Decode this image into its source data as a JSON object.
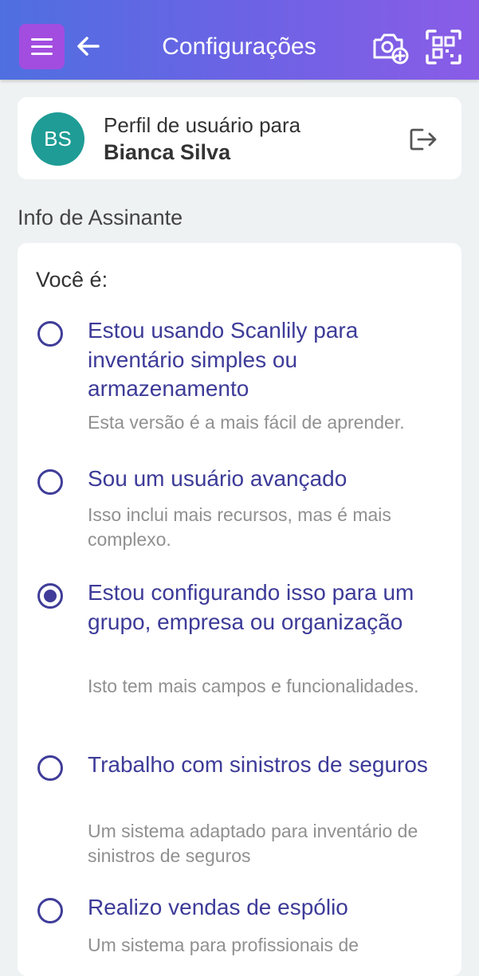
{
  "header": {
    "title": "Configurações",
    "menu_icon": "hamburger-menu-icon",
    "back_icon": "arrow-left-icon",
    "camera_icon": "camera-add-icon",
    "qr_icon": "qr-scan-icon",
    "accent_color": "#a24de0"
  },
  "profile": {
    "initials": "BS",
    "label": "Perfil de usuário para",
    "name": "Bianca Silva",
    "logout_icon": "logout-icon",
    "avatar_color": "#1e9c95"
  },
  "section": {
    "label": "Info de Assinante"
  },
  "options_card": {
    "question": "Você é:",
    "options": [
      {
        "title": "Estou usando Scanlily para inventário simples ou armazenamento",
        "description": "Esta versão é a mais fácil de aprender.",
        "selected": false
      },
      {
        "title": "Sou um usuário avançado",
        "description": "Isso inclui mais recursos, mas é mais complexo.",
        "selected": false
      },
      {
        "title": "Estou configurando isso para um grupo, empresa ou organização",
        "description": "Isto tem mais campos e funcionalidades.",
        "selected": true
      },
      {
        "title": "Trabalho com sinistros de seguros",
        "description": "Um sistema adaptado para inventário de sinistros de seguros",
        "selected": false
      },
      {
        "title": "Realizo vendas de espólio",
        "description": "Um sistema para profissionais de",
        "selected": false
      }
    ]
  }
}
